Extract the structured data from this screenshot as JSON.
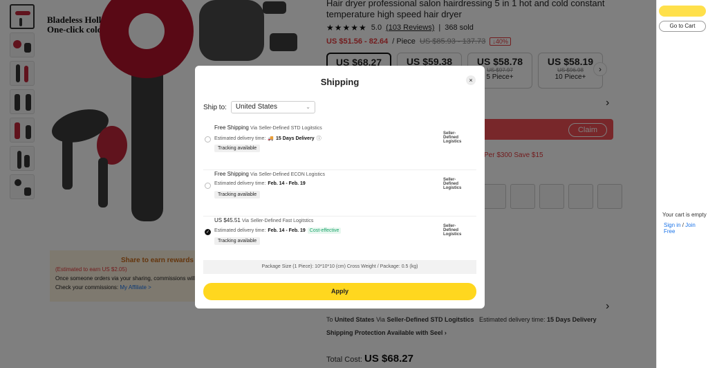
{
  "product": {
    "title": "Hair dryer professional salon hairdressing 5 in 1 hot and cold constant temperature high speed hair dryer",
    "hero_text_1": "Bladeless Hollow",
    "hero_text_2": "One-click cold air",
    "stars": "★★★★★",
    "rating": "5.0",
    "reviews": "(103 Reviews)",
    "sold": "368 sold",
    "price_range": "US $51.56 - 82.64",
    "price_unit": "/ Piece",
    "old_price_range": "US $85.93 - 137.73",
    "discount": "↓40%",
    "tiers": [
      {
        "price": "US $68.27",
        "old": "",
        "qty": ""
      },
      {
        "price": "US $59.38",
        "old": "",
        "qty": ""
      },
      {
        "price": "US $58.78",
        "old": "US $97.97",
        "qty": "5 Piece+"
      },
      {
        "price": "US $58.19",
        "old": "US $96.98",
        "qty": "10 Piece+"
      }
    ],
    "claim": "Claim",
    "save_text": "Per $300 Save $15",
    "share_title": "Share to earn rewards",
    "share_earn": "(Estimated to earn US $2.05)",
    "share_desc": "Once someone orders via your sharing, commissions will",
    "share_check": "Check your commissions:",
    "share_link": "My Affiliate >",
    "ship_to_prefix": "To",
    "ship_country": "United States",
    "ship_via": "Via",
    "ship_service": "Seller-Defined STD Logitstics",
    "ship_est": "Estimated delivery time:",
    "ship_days": "15 Days Delivery",
    "protection": "Shipping Protection Available with Seel",
    "total_label": "Total Cost:",
    "total_value": "US $68.27"
  },
  "cart": {
    "go_to_cart": "Go to Cart",
    "empty": "Your cart is empty",
    "sign_in": "Sign in",
    "join": "Join Free"
  },
  "modal": {
    "title": "Shipping",
    "close": "×",
    "ship_to_label": "Ship to:",
    "country": "United States",
    "options": [
      {
        "price": "Free Shipping",
        "via": "Via",
        "method": "Seller-Defined STD Logitstics",
        "est_label": "Estimated delivery time:",
        "est_value": "15 Days Delivery",
        "tag": "",
        "tracking": "Tracking available",
        "logo": "Seller-Defined Logistics",
        "selected": false
      },
      {
        "price": "Free Shipping",
        "via": "Via",
        "method": "Seller-Defined ECON Logistics",
        "est_label": "Estimated delivery time:",
        "est_value": "Feb. 14 - Feb. 19",
        "tag": "",
        "tracking": "Tracking available",
        "logo": "Seller-Defined Logistics",
        "selected": false
      },
      {
        "price": "US $45.51",
        "via": "Via",
        "method": "Seller-Defined Fast Logitstics",
        "est_label": "Estimated delivery time:",
        "est_value": "Feb. 14 - Feb. 19",
        "tag": "Cost-effective",
        "tracking": "Tracking available",
        "logo": "Seller-Defined Logistics",
        "selected": true
      }
    ],
    "package": "Package Size (1 Piece): 10*10*10 (cm)   Cross Weight / Package: 0.5 (kg)",
    "apply": "Apply"
  }
}
